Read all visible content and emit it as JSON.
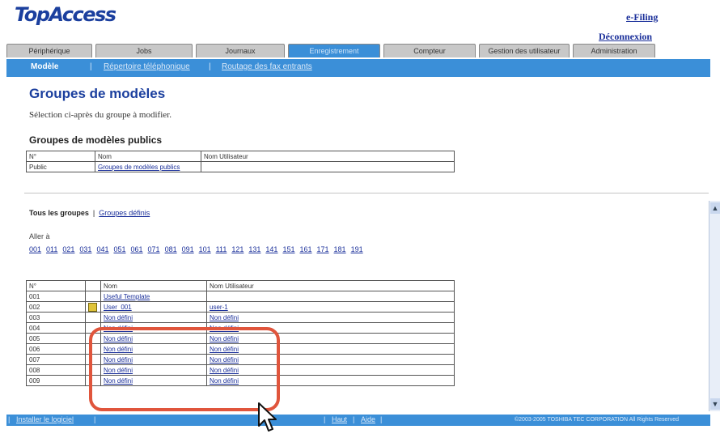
{
  "header": {
    "logo": "TopAccess",
    "efiling": "e-Filing",
    "logout": "Déconnexion"
  },
  "tabs": [
    "Périphérique",
    "Jobs",
    "Journaux",
    "Enregistrement",
    "Compteur",
    "Gestion des utilisateur",
    "Administration"
  ],
  "subnav": {
    "items": [
      "Modèle",
      "Répertoire téléphonique",
      "Routage des fax entrants"
    ],
    "separator": "|"
  },
  "main": {
    "title": "Groupes de modèles",
    "description": "Sélection ci-après du groupe à modifier.",
    "public_title": "Groupes de modèles publics",
    "public_table": {
      "headers": [
        "N°",
        "Nom",
        "Nom Utilisateur"
      ],
      "rows": [
        [
          "Public",
          "Groupes de modèles publics",
          ""
        ]
      ]
    },
    "group_tabs": {
      "all": "Tous les groupes",
      "separator": "|",
      "defined": "Groupes définis"
    },
    "aller": "Aller à",
    "jump_numbers": [
      "001",
      "011",
      "021",
      "031",
      "041",
      "051",
      "061",
      "071",
      "081",
      "091",
      "101",
      "111",
      "121",
      "131",
      "141",
      "151",
      "161",
      "171",
      "181",
      "191"
    ],
    "groups_table": {
      "headers": [
        "N°",
        "",
        "Nom",
        "Nom Utilisateur"
      ],
      "rows": [
        [
          "001",
          "",
          "Useful Template",
          ""
        ],
        [
          "002",
          "lock",
          "User_001",
          "user-1"
        ],
        [
          "003",
          "",
          "Non défini",
          "Non défini"
        ],
        [
          "004",
          "",
          "Non défini",
          "Non défini"
        ],
        [
          "005",
          "",
          "Non défini",
          "Non défini"
        ],
        [
          "006",
          "",
          "Non défini",
          "Non défini"
        ],
        [
          "007",
          "",
          "Non défini",
          "Non défini"
        ],
        [
          "008",
          "",
          "Non défini",
          "Non défini"
        ],
        [
          "009",
          "",
          "Non défini",
          "Non défini"
        ]
      ]
    }
  },
  "footer": {
    "install": "Installer le logiciel",
    "sep": "|",
    "top": "Haut",
    "help": "Aide",
    "copyright": "©2003-2005 TOSHIBA TEC CORPORATION All Rights Reserved"
  },
  "colors": {
    "accent": "#3b8fd8",
    "highlight": "#e0553c",
    "title": "#1b3f9e"
  }
}
